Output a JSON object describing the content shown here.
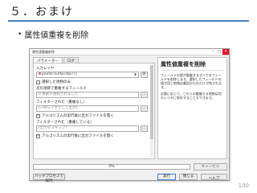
{
  "slide": {
    "title": "５．おまけ",
    "bullet": "属性値重複を削除",
    "page_number": "100"
  },
  "dialog": {
    "window_title": "属性値重複削除",
    "tabs": [
      "パラメーター",
      "ログ"
    ],
    "params": {
      "input_layer_label": "入力レイヤ",
      "input_layer_value": "points [EPSG:6677]",
      "selected_only_label": "選択した地物のみ",
      "field_label": "次の項目で重複するフィールド",
      "field_value": "0 要素が選択されました",
      "filtered_label": "フィルターされた（重複なし）",
      "filtered_value": "[一時レイヤとして出力]",
      "open_after_1": "アルゴリズムの実行後に出力ファイルを開く",
      "duplicates_label": "フィルターされた（重複している）",
      "duplicates_value": "[出力をスキップ]",
      "open_after_2": "アルゴリズムの実行後に出力ファイルを開く",
      "browse_glyph": "…"
    },
    "help": {
      "title": "属性値重複を削除",
      "para1": "フィールドの値が重複するすべてのフィールドを削除します。選択したフィールドの値が同じ地物は最初のものだけが残されます。",
      "para2": "必要に応じて、これらの重複する地物は別のレイヤに保存することもできます。"
    },
    "progress": {
      "text": "0%",
      "value": 0
    },
    "buttons": {
      "cancel": "キャンセル",
      "batch": "バッチプロセスで実行",
      "run": "実行",
      "close": "閉じる",
      "help": "ヘルプ"
    },
    "window_controls": {
      "minimize": "–",
      "maximize": "□",
      "close": "✕"
    }
  },
  "colors": {
    "accent": "#4a7fb5",
    "progress": "#5b9bd5",
    "close_red": "#e81123"
  }
}
